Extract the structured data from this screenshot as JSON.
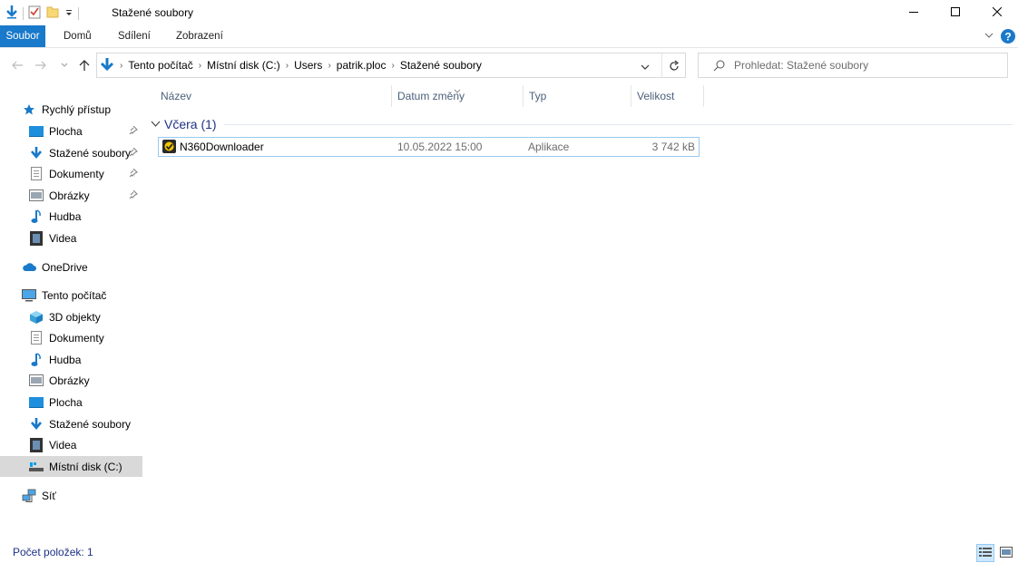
{
  "window": {
    "title": "Stažené soubory"
  },
  "ribbon": {
    "tabs": [
      "Soubor",
      "Domů",
      "Sdílení",
      "Zobrazení"
    ]
  },
  "address": {
    "crumbs": [
      "Tento počítač",
      "Místní disk (C:)",
      "Users",
      "patrik.ploc",
      "Stažené soubory"
    ]
  },
  "search": {
    "placeholder": "Prohledat: Stažené soubory"
  },
  "sidebar": {
    "quick_access": "Rychlý přístup",
    "quick_items": [
      "Plocha",
      "Stažené soubory",
      "Dokumenty",
      "Obrázky",
      "Hudba",
      "Videa"
    ],
    "onedrive": "OneDrive",
    "this_pc": "Tento počítač",
    "pc_items": [
      "3D objekty",
      "Dokumenty",
      "Hudba",
      "Obrázky",
      "Plocha",
      "Stažené soubory",
      "Videa",
      "Místní disk (C:)"
    ],
    "network": "Síť"
  },
  "columns": [
    "Název",
    "Datum změny",
    "Typ",
    "Velikost"
  ],
  "group": {
    "label": "Včera (1)"
  },
  "files": [
    {
      "name": "N360Downloader",
      "date": "10.05.2022 15:00",
      "type": "Aplikace",
      "size": "3 742 kB"
    }
  ],
  "status": {
    "count": "Počet položek: 1"
  },
  "colors": {
    "accent": "#1979ca",
    "group_text": "#1e3287",
    "selection_border": "#99c9ef"
  }
}
